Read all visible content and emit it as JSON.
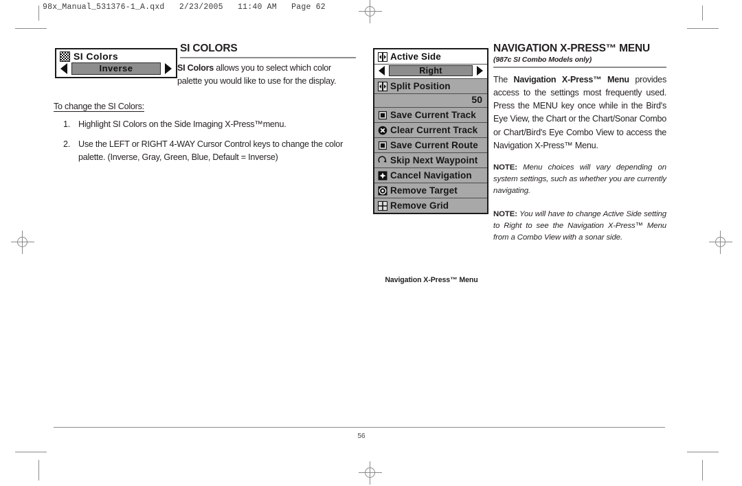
{
  "file_header": "98x_Manual_531376-1_A.qxd   2/23/2005   11:40 AM   Page 62",
  "left": {
    "widget": {
      "icon": "checker-icon",
      "title": "SI Colors",
      "value": "Inverse",
      "arrow_left": "left-arrow-icon",
      "arrow_right": "right-arrow-icon"
    },
    "section_title": "SI COLORS",
    "intro_bold": "SI Colors",
    "intro_rest": " allows you to select which color palette you would like to use for the display.",
    "subheading": "To change the SI Colors:",
    "steps": [
      {
        "num": "1.",
        "text": "Highlight SI Colors on the Side Imaging X-Press™menu."
      },
      {
        "num": "2.",
        "text": "Use the LEFT or RIGHT 4-WAY Cursor Control keys to change the color palette. (Inverse, Gray, Green, Blue, Default = Inverse)"
      }
    ]
  },
  "center": {
    "menu_rows": [
      {
        "label": "Active Side",
        "icon": "active-side-icon",
        "selected": true,
        "value": "Right"
      },
      {
        "label": "Split Position",
        "icon": "split-position-icon",
        "selected": false,
        "number": "50"
      },
      {
        "label": "Save Current Track",
        "icon": "save-icon",
        "selected": false
      },
      {
        "label": "Clear Current Track",
        "icon": "clear-x-icon",
        "selected": false
      },
      {
        "label": "Save Current Route",
        "icon": "save-icon",
        "selected": false
      },
      {
        "label": "Skip Next Waypoint",
        "icon": "skip-waypoint-icon",
        "selected": false
      },
      {
        "label": "Cancel Navigation",
        "icon": "cancel-navigation-icon",
        "selected": false
      },
      {
        "label": "Remove Target",
        "icon": "target-icon",
        "selected": false
      },
      {
        "label": "Remove Grid",
        "icon": "grid-icon",
        "selected": false
      }
    ],
    "caption": "Navigation X-Press™ Menu"
  },
  "right": {
    "section_title": "NAVIGATION X-PRESS™ MENU",
    "subtitle": "(987c SI Combo Models only)",
    "body_pre": "The ",
    "body_bold": "Navigation X-Press™ Menu",
    "body_rest": " provides access to the settings most frequently used. Press the MENU key once while in the Bird's Eye View, the Chart or the Chart/Sonar Combo or Chart/Bird's Eye Combo View to access the Navigation X-Press™ Menu.",
    "notes": [
      {
        "label": "NOTE:",
        "text": " Menu choices will vary depending on system settings, such as whether you are currently navigating."
      },
      {
        "label": "NOTE:",
        "text": " You will have to change Active Side setting to Right to see the Navigation X-Press™ Menu from a Combo View with a sonar side."
      }
    ]
  },
  "footer": {
    "page_number": "56"
  },
  "colors": {
    "menu_bg": "#a8a8a8",
    "selected_bg": "#ffffff",
    "value_box": "#8d8d8d",
    "rule": "#8c8c8c",
    "text": "#231f20"
  }
}
